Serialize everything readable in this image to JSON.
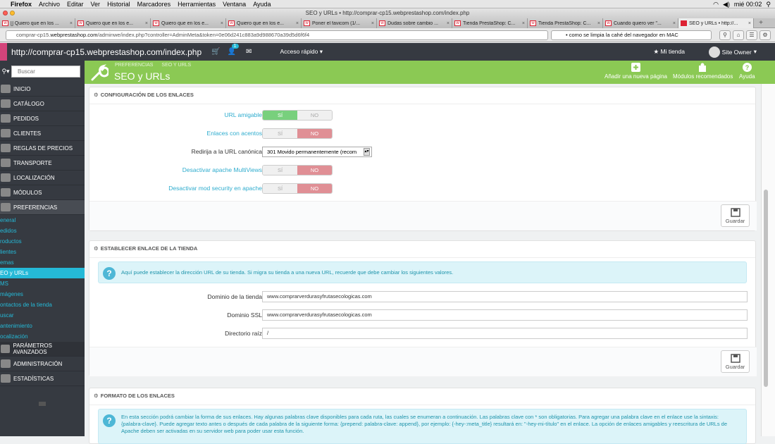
{
  "macmenu": {
    "apple": "",
    "items": [
      "Firefox",
      "Archivo",
      "Editar",
      "Ver",
      "Historial",
      "Marcadores",
      "Herramientas",
      "Ventana",
      "Ayuda"
    ],
    "clock": "mié 00:02"
  },
  "window": {
    "title": "SEO y URLs • http://comprar-cp15.webprestashop.com/index.php"
  },
  "tabs": [
    {
      "label": "[] Quiero que en los ..."
    },
    {
      "label": "Quiero que en los e..."
    },
    {
      "label": "Quiero que en los e..."
    },
    {
      "label": "Quiero que en los e..."
    },
    {
      "label": "Poner el favicom (1/..."
    },
    {
      "label": "Dudas sobre cambio ..."
    },
    {
      "label": "Tienda PrestaShop: C..."
    },
    {
      "label": "Tienda PrestaShop: C..."
    },
    {
      "label": "Cuando quiero ver \"..."
    },
    {
      "label": "SEO y URLs • http://..."
    }
  ],
  "addressbar": {
    "url_prefix": "comprar-cp15.",
    "url_domain": "webprestashop.com",
    "url_rest": "/adminwe/index.php?controller=AdminMeta&token=0e06d241c883a9d988670a39d5d6f6f4",
    "search": "• como se limpia la cahé del navegador en MAC"
  },
  "header": {
    "site_url": "http://comprar-cp15.webprestashop.com/index.php",
    "notif_count": "1",
    "quick_access": "Acceso rápido",
    "my_store": "Mi tienda",
    "owner": "Site Owner"
  },
  "sidebar": {
    "search_placeholder": "Buscar",
    "items": [
      {
        "label": "INICIO"
      },
      {
        "label": "CATÁLOGO"
      },
      {
        "label": "PEDIDOS"
      },
      {
        "label": "CLIENTES"
      },
      {
        "label": "REGLAS DE PRECIOS"
      },
      {
        "label": "TRANSPORTE"
      },
      {
        "label": "LOCALIZACIÓN"
      },
      {
        "label": "MÓDULOS"
      },
      {
        "label": "PREFERENCIAS"
      }
    ],
    "subitems": [
      {
        "label": "eneral"
      },
      {
        "label": "edidos"
      },
      {
        "label": "roductos"
      },
      {
        "label": "lientes"
      },
      {
        "label": "emas"
      },
      {
        "label": "EO y URLs"
      },
      {
        "label": "MS"
      },
      {
        "label": "mágenes"
      },
      {
        "label": "ontactos de la tienda"
      },
      {
        "label": "uscar"
      },
      {
        "label": "antenimiento"
      },
      {
        "label": "ocalización"
      }
    ],
    "bottom_items": [
      {
        "label": "PARÁMETROS AVANZADOS"
      },
      {
        "label": "ADMINISTRACIÓN"
      },
      {
        "label": "ESTADÍSTICAS"
      }
    ]
  },
  "pagehead": {
    "breadcrumb": [
      "PREFERENCIAS",
      "SEO Y URLS"
    ],
    "title": "SEO y URLs",
    "actions": [
      {
        "label": "Añadir una nueva página"
      },
      {
        "label": "Módulos recomendados"
      },
      {
        "label": "Ayuda"
      }
    ]
  },
  "links_config": {
    "title": "CONFIGURACIÓN DE LOS ENLACES",
    "yes": "SÍ",
    "no": "NO",
    "friendly_url": {
      "label": "URL amigable",
      "value": "SÍ"
    },
    "accented_url": {
      "label": "Enlaces con acentos",
      "value": "NO"
    },
    "canonical": {
      "label": "Redirija a la URL canónica",
      "value": "301 Movido permanentemente (recom"
    },
    "multiviews": {
      "label": "Desactivar apache MultiViews",
      "value": "NO"
    },
    "modsecurity": {
      "label": "Desactivar mod security en apache",
      "value": "NO"
    },
    "save": "Guardar"
  },
  "shop_url": {
    "title": "ESTABLECER ENLACE DE LA TIENDA",
    "info": "Aquí puede establecer la dirección URL de su tienda. Si migra su tienda a una nueva URL, recuerde que debe cambiar los siguientes valores.",
    "domain": {
      "label": "Dominio de la tienda",
      "value": "www.comprarverdurasyfrutasecologicas.com"
    },
    "ssl": {
      "label": "Dominio SSL",
      "value": "www.comprarverdurasyfrutasecologicas.com"
    },
    "root": {
      "label": "Directorio raíz",
      "value": "/"
    },
    "save": "Guardar"
  },
  "schema": {
    "title": "FORMATO DE LOS ENLACES",
    "info": "En esta sección podrá cambiar la forma de sus enlaces. Hay algunas palabras clave disponibles para cada ruta, las cuales se enumeran a continuación. Las palabras clave con * son obligatorias. Para agregar una palabra clave en el enlace use la sintaxis: {palabra-clave}. Puede agregar texto antes o después de cada palabra de la siguiente forma: {prepend: palabra-clave: append}, por ejemplo: {-hey-:meta_title} resultará en: \"-hey-mi-título\" en el enlace. La opción de enlaces amigables y reescritura de URLs de Apache deben ser activadas en su servidor web para poder usar esta función."
  },
  "colors": {
    "green": "#8bc954",
    "dark": "#363a41",
    "cyan": "#25b9d7",
    "yes_on": "#78d07d",
    "no_on": "#e08f95"
  }
}
